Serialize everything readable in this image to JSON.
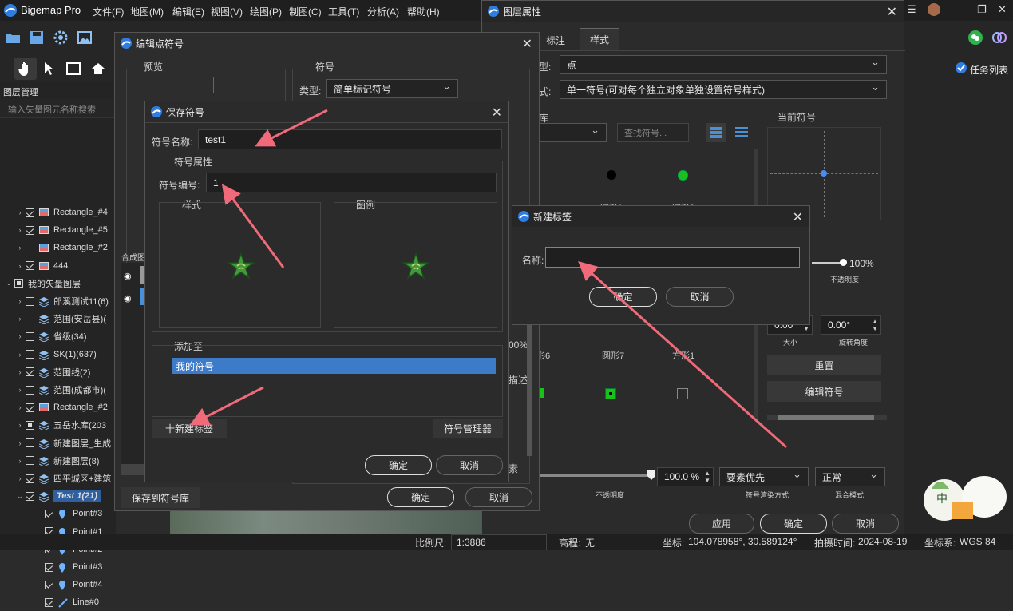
{
  "app": {
    "name": "Bigemap Pro"
  },
  "menu": [
    "文件(F)",
    "地图(M)",
    "编辑(E)",
    "视图(V)",
    "绘图(P)",
    "制图(C)",
    "工具(T)",
    "分析(A)",
    "帮助(H)"
  ],
  "task_list": "任务列表",
  "layer_panel": {
    "title": "图层管理",
    "search_placeholder": "输入矢量图元名称搜索",
    "rows": [
      {
        "label": "Rectangle_#4",
        "check": "on",
        "indent": 1
      },
      {
        "label": "Rectangle_#5",
        "check": "on",
        "indent": 1
      },
      {
        "label": "Rectangle_#2",
        "check": "off",
        "indent": 1
      },
      {
        "label": "444",
        "check": "on",
        "indent": 1
      },
      {
        "label": "我的矢量图层",
        "check": "part",
        "indent": 0
      },
      {
        "label": "郎溪测试11(6)",
        "check": "off",
        "indent": 1
      },
      {
        "label": "范围(安岳县)(",
        "check": "off",
        "indent": 1
      },
      {
        "label": "省级(34)",
        "check": "off",
        "indent": 1
      },
      {
        "label": "SK(1)(637)",
        "check": "off",
        "indent": 1
      },
      {
        "label": "范围线(2)",
        "check": "on",
        "indent": 1
      },
      {
        "label": "范围(成都市)(",
        "check": "off",
        "indent": 1
      },
      {
        "label": "Rectangle_#2",
        "check": "on",
        "indent": 1
      },
      {
        "label": "五岳水库(203",
        "check": "part",
        "indent": 1
      },
      {
        "label": "新建图层_生成",
        "check": "off",
        "indent": 1
      },
      {
        "label": "新建图层(8)",
        "check": "off",
        "indent": 1
      },
      {
        "label": "四平城区+建筑",
        "check": "on",
        "indent": 1
      },
      {
        "label": "Test 1(21)",
        "check": "on",
        "indent": 1,
        "selected": true
      },
      {
        "label": "Point#3",
        "check": "on",
        "indent": 2
      },
      {
        "label": "Point#1",
        "check": "on",
        "indent": 2
      },
      {
        "label": "Point#2",
        "check": "on",
        "indent": 2
      },
      {
        "label": "Point#3",
        "check": "on",
        "indent": 2
      },
      {
        "label": "Point#4",
        "check": "on",
        "indent": 2
      },
      {
        "label": "Line#0",
        "check": "on",
        "indent": 2
      }
    ]
  },
  "layer_props": {
    "title": "图层属性",
    "tabs": [
      "标注",
      "样式"
    ],
    "type_label": "型:",
    "type_value": "点",
    "mode_label": "式:",
    "mode_value": "单一符号(可对每个独立对象单独设置符号样式)",
    "lib_label": "库",
    "search_placeholder": "查找符号...",
    "current_symbol": "当前符号",
    "symbols_row1": [
      "圆形1",
      "圆形2"
    ],
    "symbols_row2": [
      "形6",
      "圆形7",
      "方形1"
    ],
    "opacity_value": "100%",
    "opacity_label": "不透明度",
    "size_value": "0.00",
    "size_label": "大小",
    "angle_value": "0.00°",
    "angle_label": "旋转角度",
    "reset": "重置",
    "edit_symbol": "编辑符号",
    "bottom_opacity_value": "100.0 %",
    "bottom_opacity_label": "不透明度",
    "render_mode": "要素优先",
    "render_label": "符号渲染方式",
    "blend_mode": "正常",
    "blend_label": "混合模式",
    "apply": "应用",
    "ok": "确定",
    "cancel": "取消",
    "side_label": "描述",
    "pct": "00%"
  },
  "edit_symbol": {
    "title": "编辑点符号",
    "preview": "预览",
    "symbol_group": "符号",
    "type_label": "类型:",
    "type_value": "简单标记符号",
    "composite": "合成图标",
    "save_to_lib": "保存到符号库",
    "ok": "确定",
    "cancel": "取消",
    "elem": "素"
  },
  "save_symbol": {
    "title": "保存符号",
    "name_label": "符号名称:",
    "name_value": "test1",
    "props_group": "符号属性",
    "id_label": "符号编号:",
    "id_value": "1",
    "style_label": "样式",
    "legend_label": "图例",
    "add_to": "添加至",
    "list_item": "我的符号",
    "new_tag": "十新建标签",
    "manager": "符号管理器",
    "ok": "确定",
    "cancel": "取消"
  },
  "new_tag": {
    "title": "新建标签",
    "name_label": "名称:",
    "name_value": "",
    "ok": "确定",
    "cancel": "取消"
  },
  "statusbar": {
    "scale_label": "比例尺:",
    "scale_value": "1:3886",
    "elev_label": "高程:",
    "elev_value": "无",
    "coord_label": "坐标:",
    "coord_value": "104.078958°, 30.589124°",
    "date_label": "拍摄时间:",
    "date_value": "2024-08-19",
    "crs_label": "坐标系:",
    "crs_value": "WGS 84"
  },
  "ime": {
    "text": "中"
  },
  "colors": {
    "accent": "#4a90d9",
    "arrow": "#f06a7a",
    "selected_row": "#2f5f9e"
  }
}
